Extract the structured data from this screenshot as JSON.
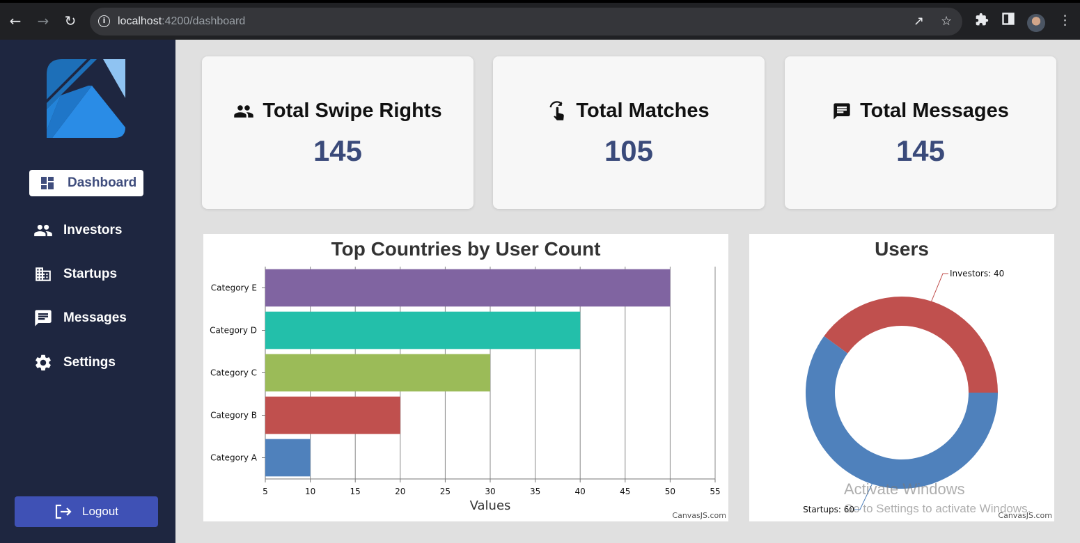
{
  "browser": {
    "url_host": "localhost",
    "url_rest": ":4200/dashboard"
  },
  "sidebar": {
    "items": [
      {
        "label": "Dashboard",
        "icon": "dashboard-icon"
      },
      {
        "label": "Investors",
        "icon": "people-icon"
      },
      {
        "label": "Startups",
        "icon": "building-icon"
      },
      {
        "label": "Messages",
        "icon": "message-icon"
      },
      {
        "label": "Settings",
        "icon": "gear-icon"
      }
    ],
    "logout_label": "Logout"
  },
  "stats": [
    {
      "title": "Total Swipe Rights",
      "value": "145",
      "icon": "people-icon"
    },
    {
      "title": "Total Matches",
      "value": "105",
      "icon": "swipe-gesture-icon"
    },
    {
      "title": "Total Messages",
      "value": "145",
      "icon": "message-icon"
    }
  ],
  "chart_data": [
    {
      "type": "bar",
      "orientation": "horizontal",
      "title": "Top Countries by User Count",
      "xlabel": "Values",
      "categories": [
        "Category A",
        "Category B",
        "Category C",
        "Category D",
        "Category E"
      ],
      "values": [
        10,
        20,
        30,
        40,
        50
      ],
      "colors": [
        "#4f81bc",
        "#c0504e",
        "#9bbb58",
        "#23bfaa",
        "#8064a1"
      ],
      "xlim": [
        5,
        55
      ],
      "xticks": [
        5,
        10,
        15,
        20,
        25,
        30,
        35,
        40,
        45,
        50,
        55
      ],
      "grid": true,
      "credit": "CanvasJS.com"
    },
    {
      "type": "doughnut",
      "title": "Users",
      "slices": [
        {
          "label": "Investors",
          "value": 40,
          "color": "#c0504e",
          "text": "Investors: 40"
        },
        {
          "label": "Startups",
          "value": 60,
          "color": "#4f81bc",
          "text": "Startups: 60"
        }
      ],
      "credit": "CanvasJS.com"
    }
  ],
  "watermark": {
    "line1": "Activate Windows",
    "line2": "Go to Settings to activate Windows."
  }
}
